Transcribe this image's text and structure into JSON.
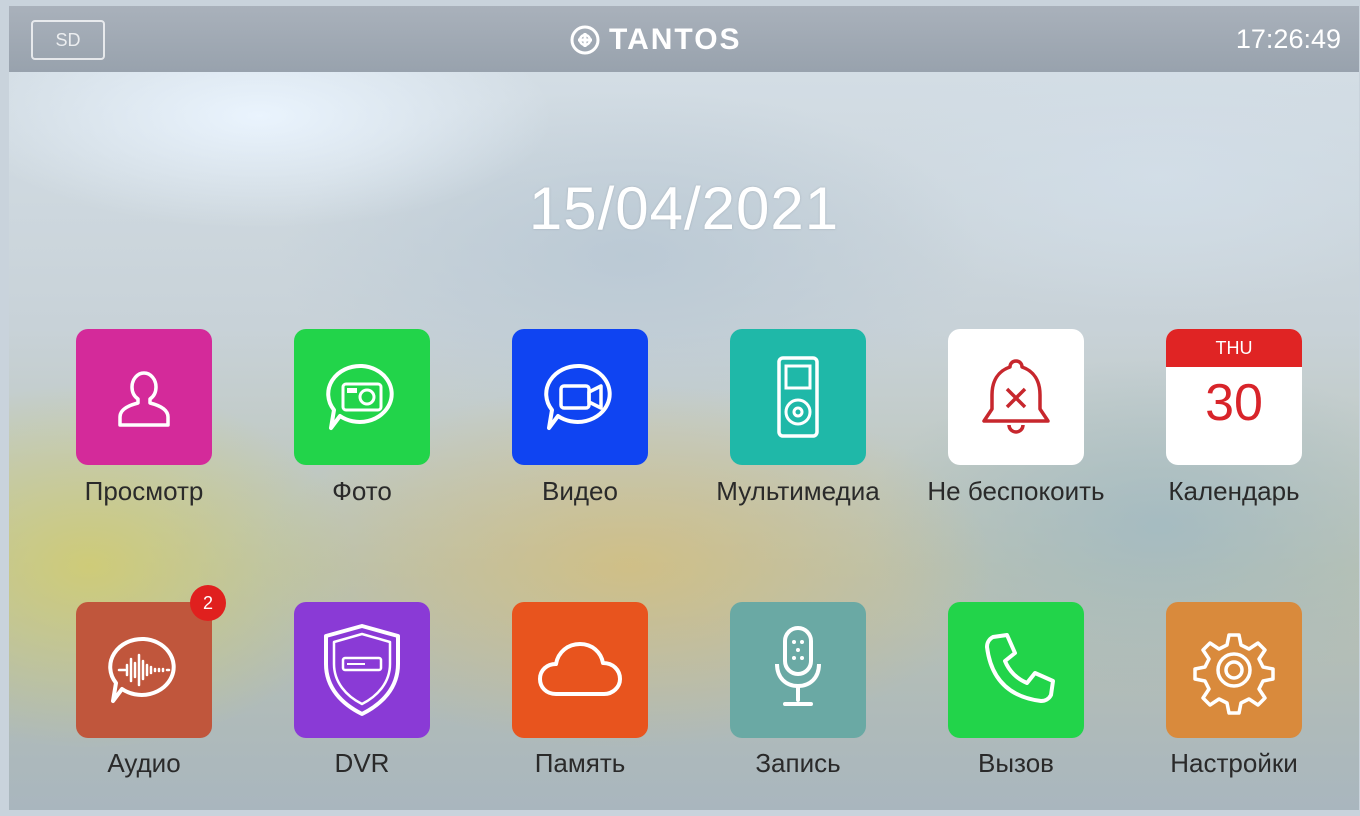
{
  "status_bar": {
    "sd_label": "SD",
    "brand_name": "TANTOS",
    "time": "17:26:49"
  },
  "date": "15/04/2021",
  "apps_row1": [
    {
      "label": "Просмотр",
      "icon": "person-icon",
      "color": "#d42a9a"
    },
    {
      "label": "Фото",
      "icon": "camera-icon",
      "color": "#22d44a"
    },
    {
      "label": "Видео",
      "icon": "video-camera-icon",
      "color": "#0f44f2"
    },
    {
      "label": "Мультимедиа",
      "icon": "media-player-icon",
      "color": "#1fb8a8"
    },
    {
      "label": "Не беспокоить",
      "icon": "bell-off-icon",
      "color": "#ffffff"
    },
    {
      "label": "Календарь",
      "icon": "calendar-icon",
      "color": "#ffffff"
    }
  ],
  "calendar": {
    "weekday": "THU",
    "day": "30"
  },
  "apps_row2": [
    {
      "label": "Аудио",
      "icon": "audio-wave-icon",
      "color": "#c0563c",
      "badge": "2"
    },
    {
      "label": "DVR",
      "icon": "dvr-shield-icon",
      "color": "#8a3ad6"
    },
    {
      "label": "Память",
      "icon": "cloud-icon",
      "color": "#e8541e"
    },
    {
      "label": "Запись",
      "icon": "microphone-icon",
      "color": "#6aa9a4"
    },
    {
      "label": "Вызов",
      "icon": "phone-icon",
      "color": "#22d44a"
    },
    {
      "label": "Настройки",
      "icon": "gear-icon",
      "color": "#d98a3c"
    }
  ]
}
